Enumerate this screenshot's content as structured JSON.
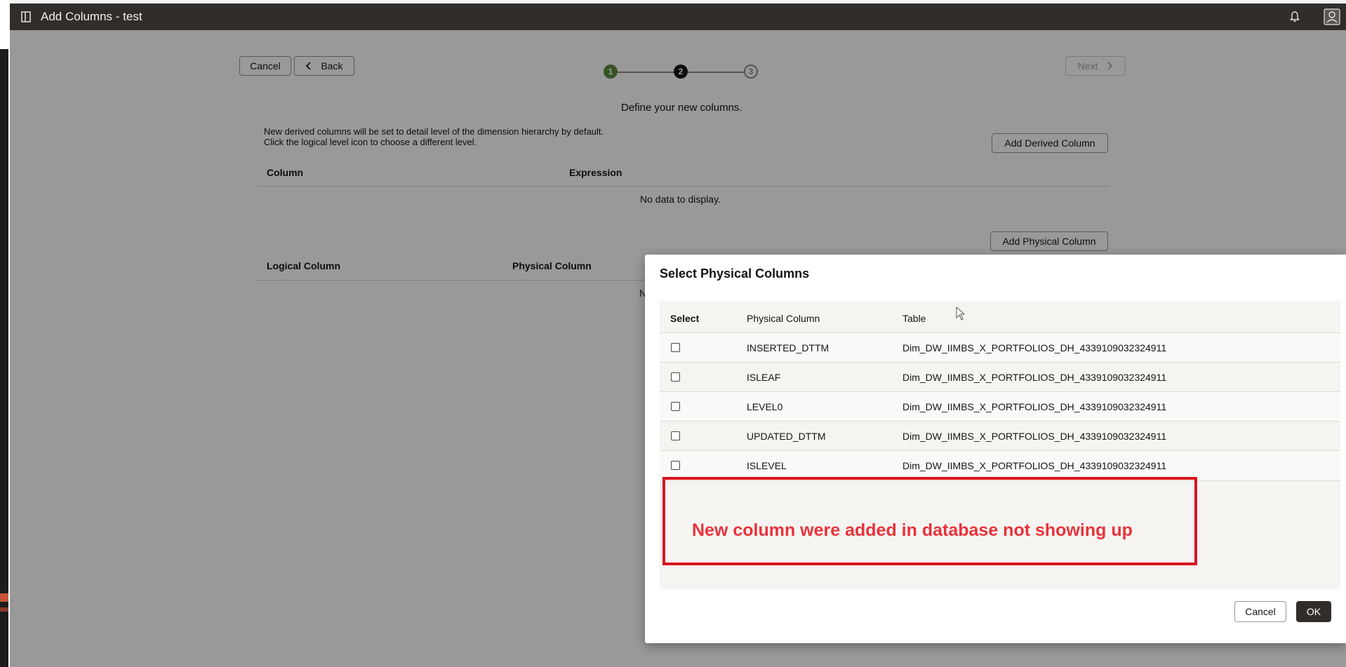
{
  "window": {
    "title": "Add Columns - test"
  },
  "toolbar": {
    "cancel_label": "Cancel",
    "back_label": "Back",
    "next_label": "Next"
  },
  "stepper": {
    "steps": [
      "1",
      "2",
      "3"
    ],
    "current": 2
  },
  "derived": {
    "heading": "Define your new columns.",
    "info_line1": "New derived columns will be set to detail level of the dimension hierarchy by default.",
    "info_line2": "Click the logical level icon to choose a different level.",
    "add_button": "Add Derived Column",
    "columns": [
      "Column",
      "Expression"
    ],
    "empty_text": "No data to display."
  },
  "physical": {
    "add_button": "Add Physical Column",
    "columns": [
      "Logical Column",
      "Physical Column"
    ],
    "empty_text_fragment": "N"
  },
  "dialog": {
    "title": "Select Physical Columns",
    "columns": [
      "Select",
      "Physical Column",
      "Table"
    ],
    "rows": [
      {
        "column": "INSERTED_DTTM",
        "table": "Dim_DW_IIMBS_X_PORTFOLIOS_DH_4339109032324911",
        "selected": false
      },
      {
        "column": "ISLEAF",
        "table": "Dim_DW_IIMBS_X_PORTFOLIOS_DH_4339109032324911",
        "selected": false
      },
      {
        "column": "LEVEL0",
        "table": "Dim_DW_IIMBS_X_PORTFOLIOS_DH_4339109032324911",
        "selected": false
      },
      {
        "column": "UPDATED_DTTM",
        "table": "Dim_DW_IIMBS_X_PORTFOLIOS_DH_4339109032324911",
        "selected": false
      },
      {
        "column": "ISLEVEL",
        "table": "Dim_DW_IIMBS_X_PORTFOLIOS_DH_4339109032324911",
        "selected": false
      }
    ],
    "cancel_label": "Cancel",
    "ok_label": "OK"
  },
  "annotation": {
    "text": "New column were added in database not showing up",
    "color": "#d7161e"
  },
  "colors": {
    "header_bg": "#312d2a",
    "step_done": "#5a8a3c",
    "step_current": "#161513",
    "primary_button": "#312d2a"
  },
  "icons": {
    "header_left": "sidebar-toggle-icon",
    "header_bell": "bell-icon",
    "header_user": "user-icon",
    "back": "chevron-left-icon",
    "next": "chevron-right-icon"
  }
}
